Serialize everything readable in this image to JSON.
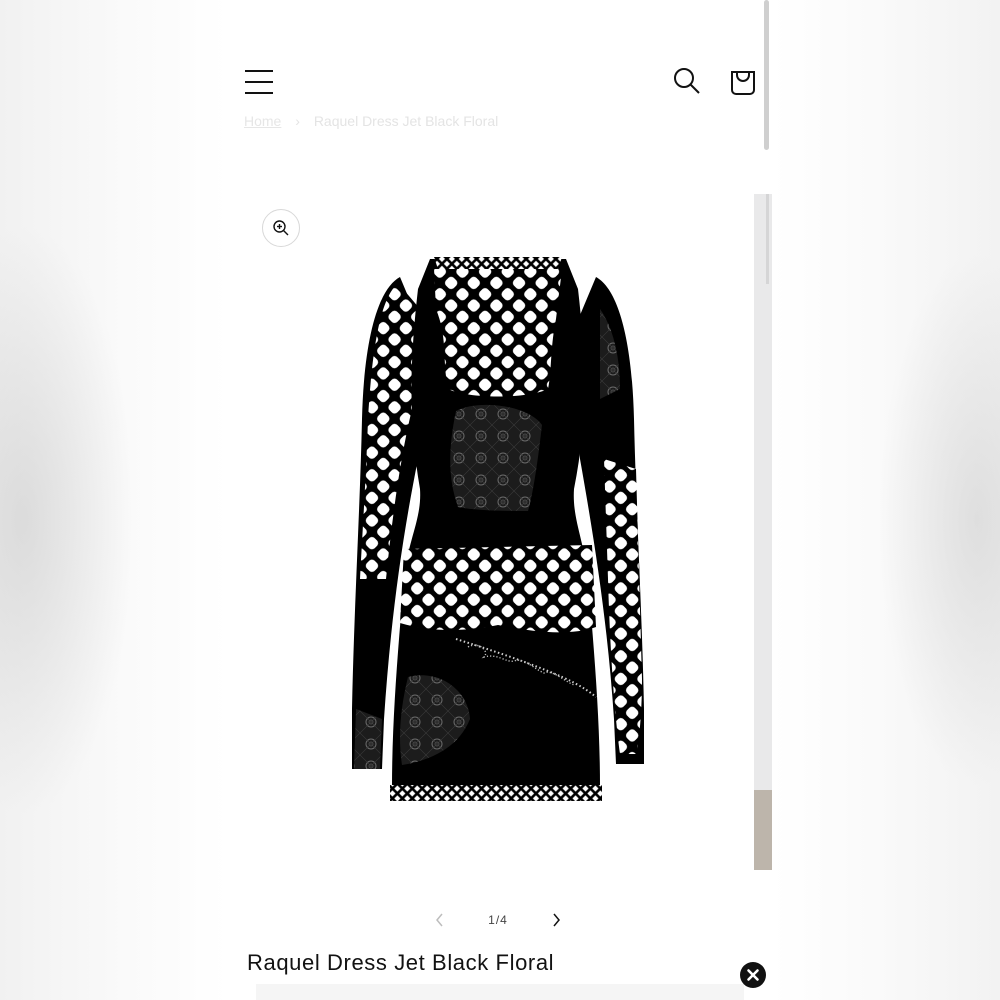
{
  "header": {
    "menu_icon": "hamburger-menu-icon",
    "search_icon": "search-icon",
    "cart_icon": "cart-icon"
  },
  "breadcrumb": {
    "home": "Home",
    "separator": "›",
    "current": "Raquel Dress Jet Black Floral"
  },
  "gallery": {
    "zoom_icon": "zoom-in-icon",
    "image_alt": "Raquel Dress Jet Black Floral",
    "pager": {
      "prev_icon": "chevron-left-icon",
      "count": "1/4",
      "next_icon": "chevron-right-icon"
    }
  },
  "product": {
    "title": "Raquel Dress Jet Black Floral"
  },
  "overlay": {
    "close_icon": "close-icon"
  }
}
